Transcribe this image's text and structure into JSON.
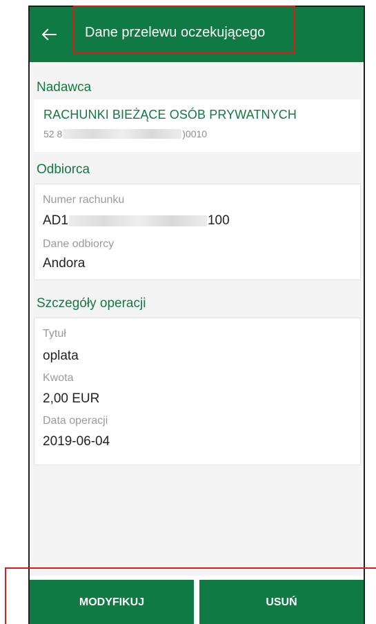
{
  "appbar": {
    "title": "Dane przelewu oczekującego",
    "back_icon": "arrow-left-icon"
  },
  "sender": {
    "section": "Nadawca",
    "account_name": "RACHUNKI BIEŻĄCE OSÓB PRYWATNYCH",
    "account_prefix": "52 8",
    "account_suffix": ")0010"
  },
  "recipient": {
    "section": "Odbiorca",
    "account_label": "Numer rachunku",
    "account_prefix": "AD1",
    "account_suffix": "100",
    "name_label": "Dane odbiorcy",
    "name": "Andora"
  },
  "details": {
    "section": "Szczegóły operacji",
    "title_label": "Tytuł",
    "title": "oplata",
    "amount_label": "Kwota",
    "amount": "2,00 EUR",
    "date_label": "Data operacji",
    "date": "2019-06-04"
  },
  "actions": {
    "modify": "MODYFIKUJ",
    "delete": "USUŃ"
  },
  "colors": {
    "brand_green": "#0f7a43",
    "highlight_red": "#e01818"
  }
}
